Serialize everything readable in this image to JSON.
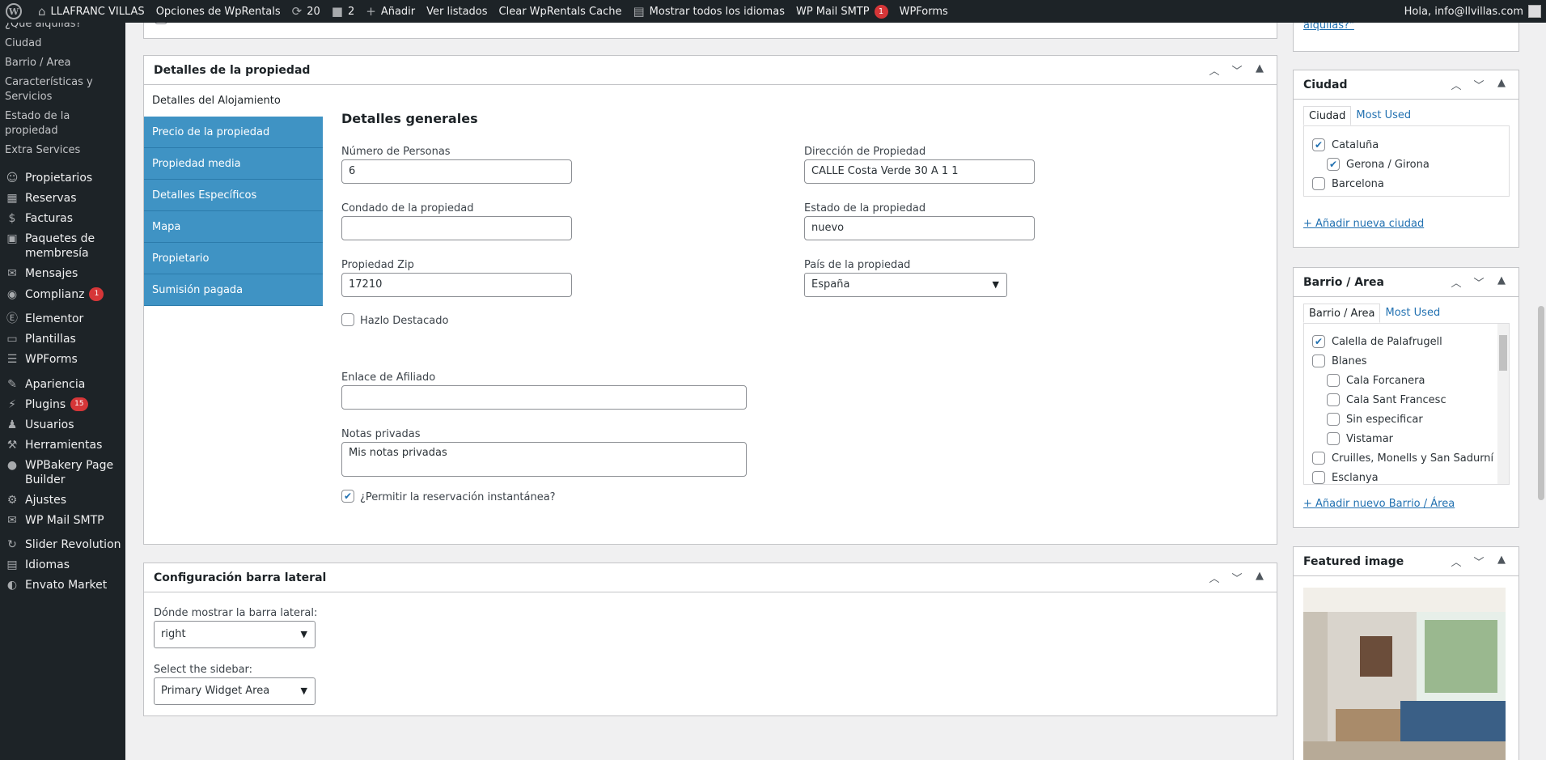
{
  "adminbar": {
    "site_name": "LLAFRANC VILLAS",
    "options": "Opciones de WpRentals",
    "updates_count": "20",
    "comments_count": "2",
    "add_new": "Añadir",
    "view_listings": "Ver listados",
    "clear_cache": "Clear WpRentals Cache",
    "languages": "Mostrar todos los idiomas",
    "smtp": "WP Mail SMTP",
    "smtp_badge": "1",
    "wpforms": "WPForms",
    "greeting": "Hola, info@llvillas.com"
  },
  "sidebar": {
    "submenu": [
      "¿Qué alquilas?",
      "Ciudad",
      "Barrio / Area",
      "Características y Servicios",
      "Estado de la propiedad",
      "Extra Services"
    ],
    "items": [
      {
        "label": "Propietarios",
        "icon": "users-icon",
        "badge": ""
      },
      {
        "label": "Reservas",
        "icon": "calendar-icon",
        "badge": ""
      },
      {
        "label": "Facturas",
        "icon": "money-icon",
        "badge": ""
      },
      {
        "label": "Paquetes de membresía",
        "icon": "package-icon",
        "badge": ""
      },
      {
        "label": "Mensajes",
        "icon": "messages-icon",
        "badge": ""
      },
      {
        "label": "Complianz",
        "icon": "complianz-icon",
        "badge": "1"
      },
      {
        "label": "Elementor",
        "icon": "elementor-icon",
        "badge": ""
      },
      {
        "label": "Plantillas",
        "icon": "folder-icon",
        "badge": ""
      },
      {
        "label": "WPForms",
        "icon": "forms-icon",
        "badge": ""
      },
      {
        "label": "Apariencia",
        "icon": "brush-icon",
        "badge": ""
      },
      {
        "label": "Plugins",
        "icon": "plugin-icon",
        "badge": "15"
      },
      {
        "label": "Usuarios",
        "icon": "user-icon",
        "badge": ""
      },
      {
        "label": "Herramientas",
        "icon": "wrench-icon",
        "badge": ""
      },
      {
        "label": "WPBakery Page Builder",
        "icon": "wpbakery-icon",
        "badge": ""
      },
      {
        "label": "Ajustes",
        "icon": "settings-icon",
        "badge": ""
      },
      {
        "label": "WP Mail SMTP",
        "icon": "mail-icon",
        "badge": ""
      },
      {
        "label": "Slider Revolution",
        "icon": "slider-icon",
        "badge": ""
      },
      {
        "label": "Idiomas",
        "icon": "languages-icon",
        "badge": ""
      },
      {
        "label": "Envato Market",
        "icon": "envato-icon",
        "badge": ""
      }
    ]
  },
  "details_box": {
    "title": "Detalles de la propiedad",
    "active_tab": "Detalles del Alojamiento",
    "tabs": [
      "Precio de la propiedad",
      "Propiedad media",
      "Detalles Específicos",
      "Mapa",
      "Propietario",
      "Sumisión pagada"
    ],
    "section_title": "Detalles generales",
    "fields": {
      "guests_label": "Número de Personas",
      "guests_value": "6",
      "county_label": "Condado de la propiedad",
      "county_value": "",
      "zip_label": "Propiedad Zip",
      "zip_value": "17210",
      "address_label": "Dirección de Propiedad",
      "address_value": "CALLE Costa Verde  30 A 1 1",
      "state_label": "Estado de la propiedad",
      "state_value": "nuevo",
      "country_label": "País de la propiedad",
      "country_value": "España",
      "featured_label": "Hazlo Destacado",
      "affiliate_label": "Enlace de Afiliado",
      "affiliate_value": "",
      "notes_label": "Notas privadas",
      "notes_value": "Mis notas privadas",
      "instant_label": "¿Permitir la reservación instantánea?"
    }
  },
  "sidebar_config": {
    "title": "Configuración barra lateral",
    "position_label": "Dónde mostrar la barra lateral:",
    "position_value": "right",
    "sidebar_label": "Select the sidebar:",
    "sidebar_value": "Primary Widget Area"
  },
  "top_right_link": "alquilas?\"",
  "city_box": {
    "title": "Ciudad",
    "tab_all": "Ciudad",
    "tab_used": "Most Used",
    "items": [
      {
        "label": "Cataluña",
        "checked": true,
        "level": 0
      },
      {
        "label": "Gerona / Girona",
        "checked": true,
        "level": 1
      },
      {
        "label": "Barcelona",
        "checked": false,
        "level": 0
      }
    ],
    "add_link": "+ Añadir nueva ciudad"
  },
  "area_box": {
    "title": "Barrio / Area",
    "tab_all": "Barrio / Area",
    "tab_used": "Most Used",
    "items": [
      {
        "label": "Calella de Palafrugell",
        "checked": true,
        "level": 0
      },
      {
        "label": "Blanes",
        "checked": false,
        "level": 0
      },
      {
        "label": "Cala Forcanera",
        "checked": false,
        "level": 1
      },
      {
        "label": "Cala Sant Francesc",
        "checked": false,
        "level": 1
      },
      {
        "label": "Sin especificar",
        "checked": false,
        "level": 1
      },
      {
        "label": "Vistamar",
        "checked": false,
        "level": 1
      },
      {
        "label": "Cruilles, Monells y San Sadurní",
        "checked": false,
        "level": 0
      },
      {
        "label": "Esclanya",
        "checked": false,
        "level": 0
      }
    ],
    "add_link": "+ Añadir nuevo Barrio / Área"
  },
  "featured_box": {
    "title": "Featured image"
  }
}
